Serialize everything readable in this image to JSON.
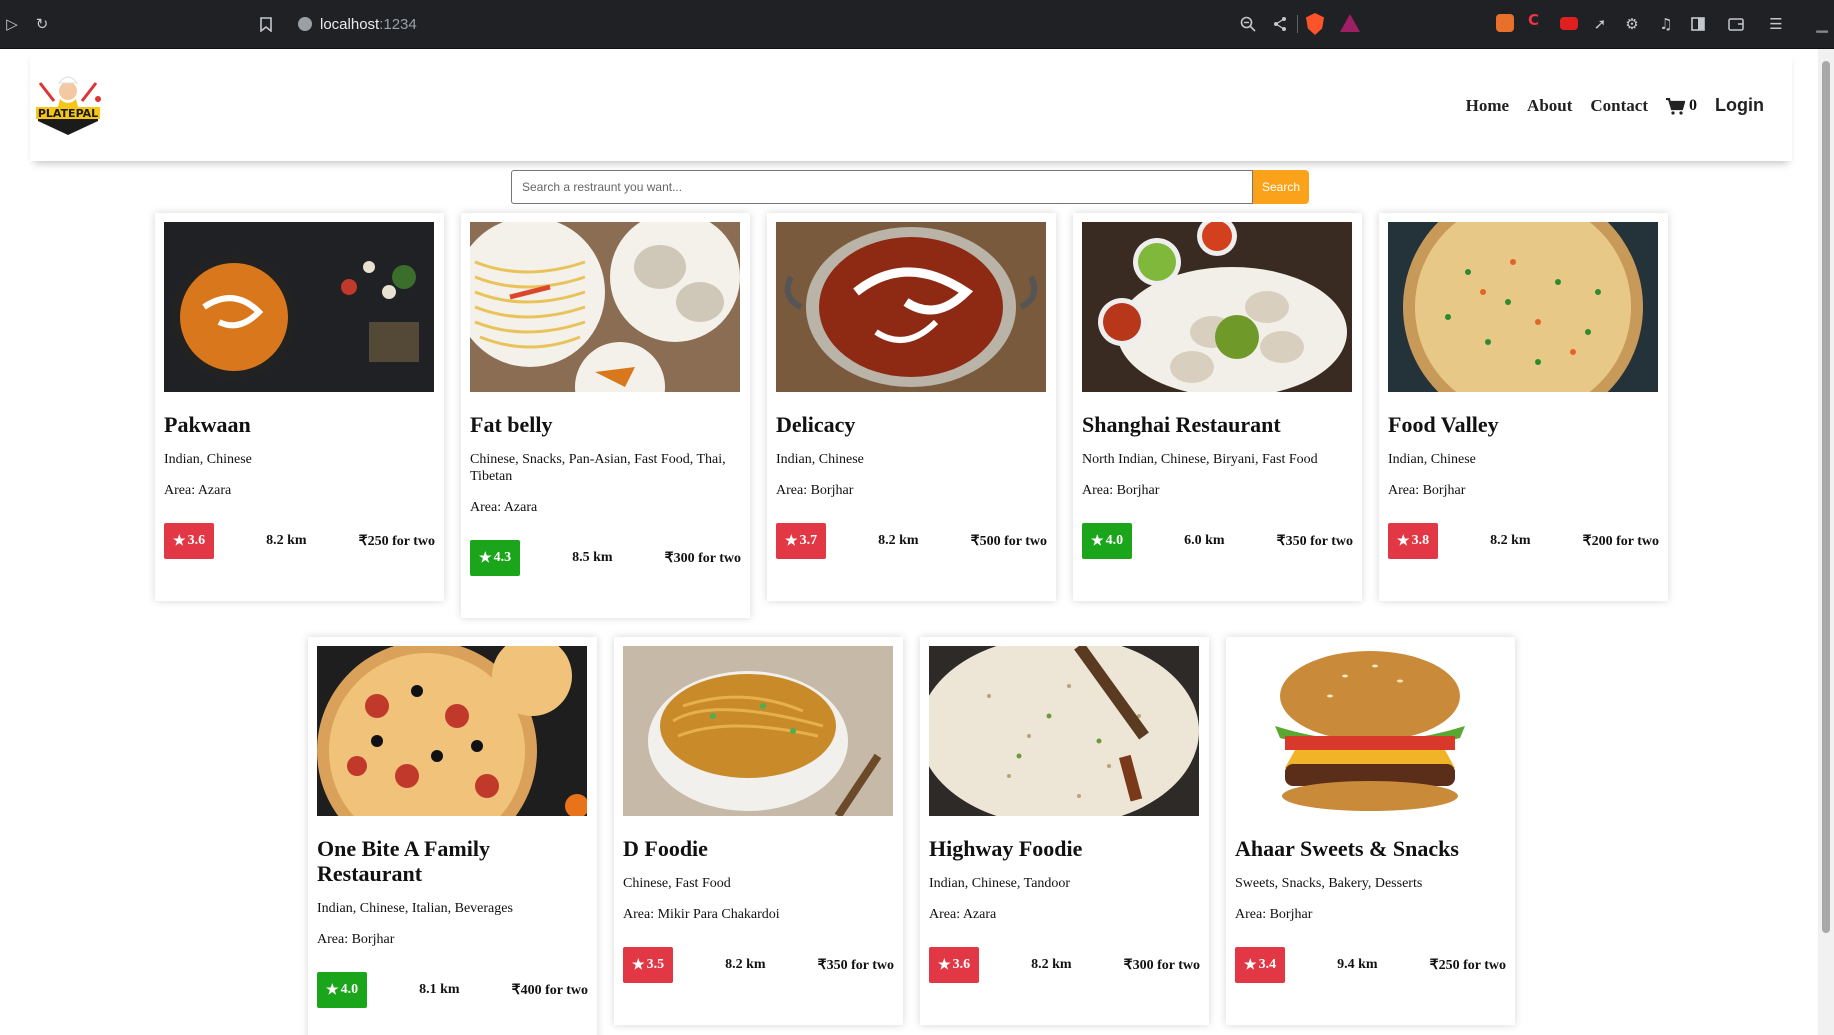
{
  "browser": {
    "url_host": "localhost",
    "url_port": ":1234"
  },
  "app": {
    "brand": "PLATEPAL",
    "nav": {
      "home": "Home",
      "about": "About",
      "contact": "Contact",
      "cart_count": "0",
      "login": "Login"
    }
  },
  "search": {
    "placeholder": "Search a restraunt you want...",
    "button": "Search"
  },
  "colors": {
    "accent": "#f9a21a",
    "rating_red": "#e23744",
    "rating_green": "#1aa51a"
  },
  "restaurants": [
    {
      "name": "Pakwaan",
      "cuisines": "Indian, Chinese",
      "area": "Area: Azara",
      "rating": "3.6",
      "rating_color": "red",
      "distance": "8.2 km",
      "cost": "₹250 for two",
      "image": "curry-bowl"
    },
    {
      "name": "Fat belly",
      "cuisines": "Chinese, Snacks, Pan-Asian, Fast Food, Thai, Tibetan",
      "area": "Area: Azara",
      "rating": "4.3",
      "rating_color": "green",
      "distance": "8.5 km",
      "cost": "₹300 for two",
      "image": "noodles-momos"
    },
    {
      "name": "Delicacy",
      "cuisines": "Indian, Chinese",
      "area": "Area: Borjhar",
      "rating": "3.7",
      "rating_color": "red",
      "distance": "8.2 km",
      "cost": "₹500 for two",
      "image": "butter-chicken-kadai"
    },
    {
      "name": "Shanghai Restaurant",
      "cuisines": "North Indian, Chinese, Biryani, Fast Food",
      "area": "Area: Borjhar",
      "rating": "4.0",
      "rating_color": "green",
      "distance": "6.0 km",
      "cost": "₹350 for two",
      "image": "momos-dips"
    },
    {
      "name": "Food Valley",
      "cuisines": "Indian, Chinese",
      "area": "Area: Borjhar",
      "rating": "3.8",
      "rating_color": "red",
      "distance": "8.2 km",
      "cost": "₹200 for two",
      "image": "fried-rice"
    },
    {
      "name": "One Bite A Family Restaurant",
      "cuisines": "Indian, Chinese, Italian, Beverages",
      "area": "Area: Borjhar",
      "rating": "4.0",
      "rating_color": "green",
      "distance": "8.1 km",
      "cost": "₹400 for two",
      "image": "pizza"
    },
    {
      "name": "D Foodie",
      "cuisines": "Chinese, Fast Food",
      "area": "Area: Mikir Para Chakardoi",
      "rating": "3.5",
      "rating_color": "red",
      "distance": "8.2 km",
      "cost": "₹350 for two",
      "image": "hakka-noodles"
    },
    {
      "name": "Highway Foodie",
      "cuisines": "Indian, Chinese, Tandoor",
      "area": "Area: Azara",
      "rating": "3.6",
      "rating_color": "red",
      "distance": "8.2 km",
      "cost": "₹300 for two",
      "image": "jeera-rice"
    },
    {
      "name": "Ahaar Sweets & Snacks",
      "cuisines": "Sweets, Snacks, Bakery, Desserts",
      "area": "Area: Borjhar",
      "rating": "3.4",
      "rating_color": "red",
      "distance": "9.4 km",
      "cost": "₹250 for two",
      "image": "burger"
    }
  ]
}
